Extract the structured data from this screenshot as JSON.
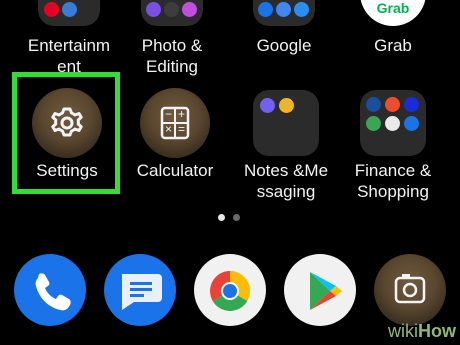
{
  "apps": {
    "entertainment": "Entertainm\nent",
    "photo_editing": "Photo &\nEditing",
    "google": "Google",
    "grab": "Grab",
    "settings": "Settings",
    "calculator": "Calculator",
    "notes": "Notes &Me\nssaging",
    "finance": "Finance &\nShopping"
  },
  "grab_icon_text": "Grab",
  "calculator_symbols": [
    "−",
    "+",
    "×",
    "="
  ],
  "watermark": {
    "wiki": "wiki",
    "how": "How"
  },
  "colors": {
    "highlight": "#33dd33",
    "wikihow_green": "#93b874"
  },
  "dock": [
    "phone-app",
    "messages-app",
    "chrome-app",
    "play-store-app",
    "camera-app"
  ]
}
